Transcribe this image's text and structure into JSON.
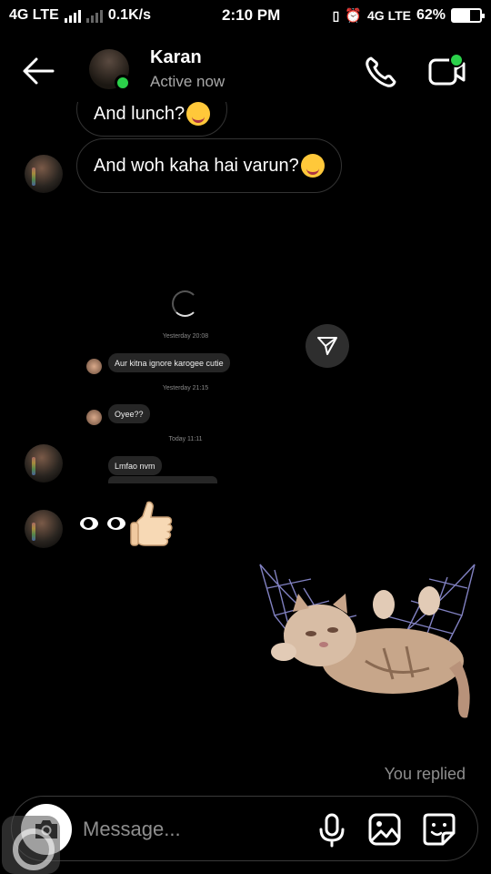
{
  "status_bar": {
    "network_left": "4G LTE",
    "speed": "0.1K/s",
    "time": "2:10 PM",
    "network_right": "4G LTE",
    "battery": "62%",
    "battery_level": 0.62
  },
  "header": {
    "name": "Karan",
    "status": "Active now"
  },
  "messages": {
    "partial_text": "And lunch?",
    "main_text": "And woh kaha hai varun?"
  },
  "embedded_screenshot": {
    "timestamp1": "Yesterday 20:08",
    "message1": "Aur kitna ignore karogee cutie",
    "timestamp2": "Yesterday 21:15",
    "message2": "Oyee??",
    "timestamp3": "Today 11:11",
    "message3": "Lmfao nvm"
  },
  "reaction": {
    "icons": [
      "eyes-emoji",
      "thumbs-up-emoji"
    ]
  },
  "you_replied": "You replied",
  "composer": {
    "placeholder": "Message..."
  },
  "colors": {
    "online": "#2bd14a",
    "bubble_border": "#333333",
    "muted_text": "#8e8e8e"
  }
}
